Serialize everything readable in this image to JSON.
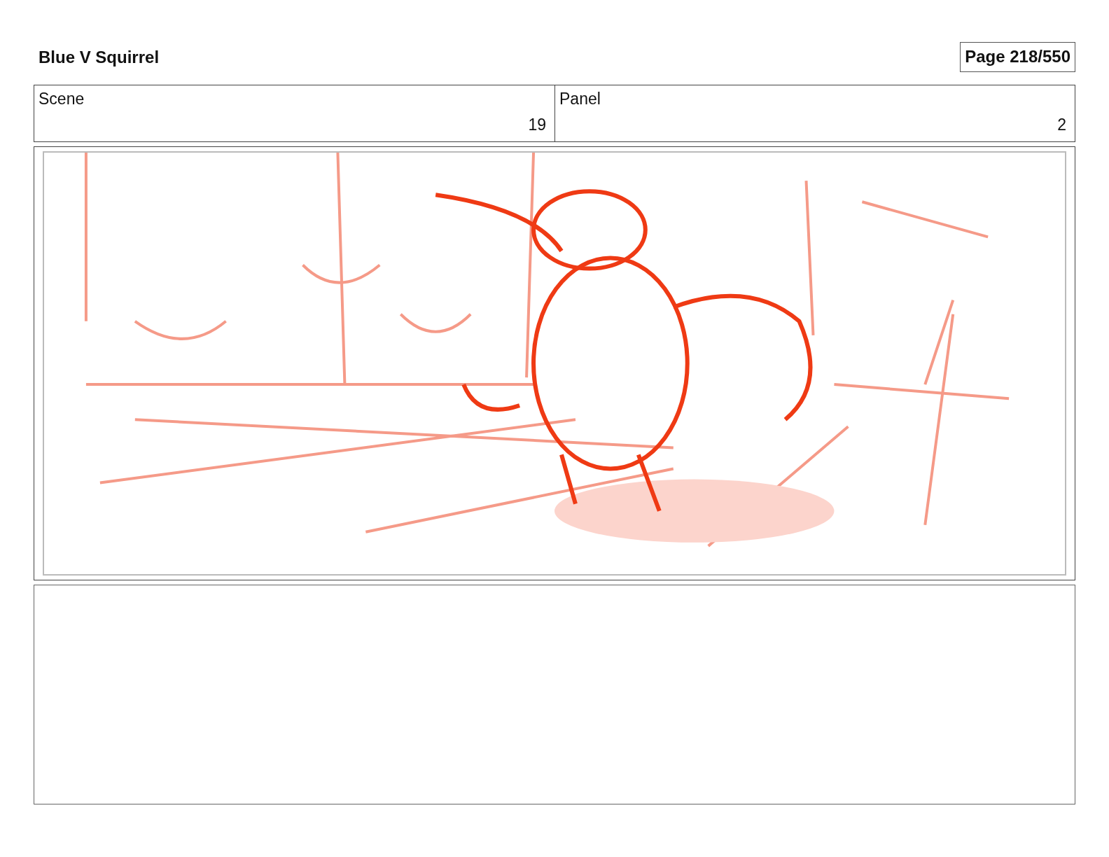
{
  "header": {
    "title": "Blue V Squirrel",
    "page": "Page 218/550"
  },
  "info_table": {
    "columns": [
      "Scene",
      "Panel"
    ],
    "row": [
      "19",
      "2"
    ]
  }
}
